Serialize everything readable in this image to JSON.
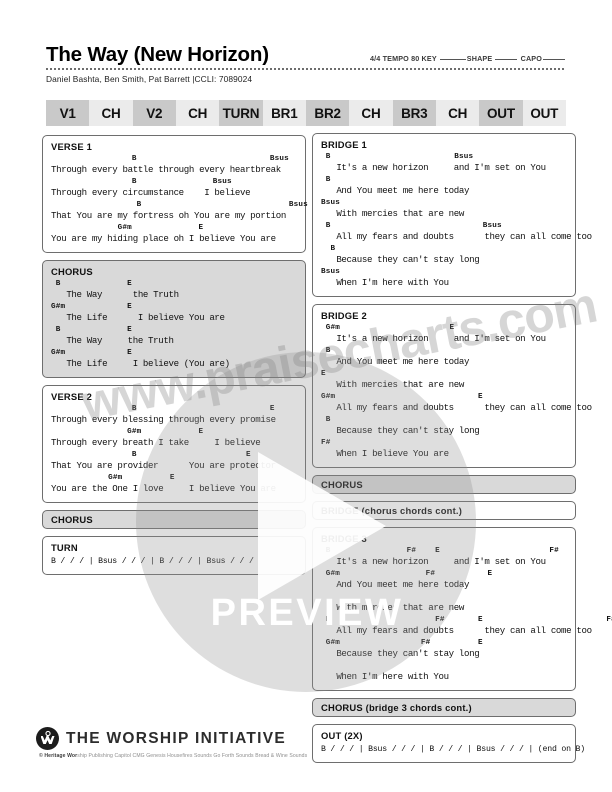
{
  "header": {
    "title": "The Way (New Horizon)",
    "authors": "Daniel Bashta, Ben Smith, Pat Barrett  |CCLI: 7089024",
    "time_signature": "4/4",
    "tempo_label": "TEMPO",
    "tempo_value": "80",
    "key_label": "KEY",
    "shape_label": "SHAPE",
    "capo_label": "CAPO"
  },
  "sequence": [
    {
      "label": "V1",
      "shade": "dark"
    },
    {
      "label": "CH",
      "shade": "light"
    },
    {
      "label": "V2",
      "shade": "dark"
    },
    {
      "label": "CH",
      "shade": "light"
    },
    {
      "label": "TURN",
      "shade": "dark"
    },
    {
      "label": "BR1",
      "shade": "light"
    },
    {
      "label": "BR2",
      "shade": "dark"
    },
    {
      "label": "CH",
      "shade": "light"
    },
    {
      "label": "BR3",
      "shade": "dark"
    },
    {
      "label": "CH",
      "shade": "light"
    },
    {
      "label": "OUT",
      "shade": "dark"
    },
    {
      "label": "OUT",
      "shade": "light"
    }
  ],
  "left_column": {
    "verse1": {
      "label": "VERSE 1",
      "lines": [
        {
          "chords": "                 B                            Bsus",
          "lyrics": "Through every battle through every heartbreak"
        },
        {
          "chords": "                 B                Bsus",
          "lyrics": "Through every circumstance    I believe"
        },
        {
          "chords": "                  B                               Bsus",
          "lyrics": "That You are my fortress oh You are my portion"
        },
        {
          "chords": "              G#m              E",
          "lyrics": "You are my hiding place oh I believe You are"
        }
      ]
    },
    "chorus1": {
      "label": "CHORUS",
      "lines": [
        {
          "chords": " B              E",
          "lyrics": "   The Way      the Truth"
        },
        {
          "chords": "G#m             E",
          "lyrics": "   The Life      I believe You are"
        },
        {
          "chords": " B              E",
          "lyrics": "   The Way     the Truth"
        },
        {
          "chords": "G#m             E",
          "lyrics": "   The Life     I believe (You are)"
        }
      ]
    },
    "verse2": {
      "label": "VERSE 2",
      "lines": [
        {
          "chords": "                 B                            E",
          "lyrics": "Through every blessing through every promise"
        },
        {
          "chords": "                G#m            E",
          "lyrics": "Through every breath I take     I believe"
        },
        {
          "chords": "                 B                       E",
          "lyrics": "That You are provider      You are protector"
        },
        {
          "chords": "            G#m          E",
          "lyrics": "You are the One I love     I believe You are"
        }
      ]
    },
    "chorus2": {
      "label": "CHORUS"
    },
    "turn": {
      "label": "TURN",
      "chords": "B / / / | Bsus / / / | B / / / | Bsus / / /"
    }
  },
  "right_column": {
    "bridge1": {
      "label": "BRIDGE 1",
      "lines": [
        {
          "chords": " B                          Bsus",
          "lyrics": "   It's a new horizon     and I'm set on You"
        },
        {
          "chords": " B",
          "lyrics": "   And You meet me here today"
        },
        {
          "chords": "Bsus",
          "lyrics": "   With mercies that are new"
        },
        {
          "chords": " B                                Bsus",
          "lyrics": "   All my fears and doubts      they can all come too"
        },
        {
          "chords": "  B",
          "lyrics": "   Because they can't stay long"
        },
        {
          "chords": "Bsus",
          "lyrics": "   When I'm here with You"
        }
      ]
    },
    "bridge2": {
      "label": "BRIDGE 2",
      "lines": [
        {
          "chords": " G#m                       E",
          "lyrics": "   It's a new horizon     and I'm set on You"
        },
        {
          "chords": " B",
          "lyrics": "   And You meet me here today"
        },
        {
          "chords": "E",
          "lyrics": "   With mercies that are new"
        },
        {
          "chords": "G#m                              E",
          "lyrics": "   All my fears and doubts      they can all come too"
        },
        {
          "chords": " B",
          "lyrics": "   Because they can't stay long"
        },
        {
          "chords": "F#",
          "lyrics": "   When I believe You are"
        }
      ]
    },
    "chorus3": {
      "label": "CHORUS"
    },
    "bridge_cont": {
      "label": "BRIDGE (chorus chords cont.)"
    },
    "bridge3": {
      "label": "BRIDGE 3",
      "lines": [
        {
          "chords": " B                F#    E                       F#",
          "lyrics": "   It's a new horizon     and I'm set on You"
        },
        {
          "chords": " G#m                  F#           E",
          "lyrics": "   And You meet me here today"
        },
        {
          "chords": "",
          "lyrics": "   With mercies that are new"
        },
        {
          "chords": " B                      F#       E                          F#",
          "lyrics": "   All my fears and doubts      they can all come too"
        },
        {
          "chords": " G#m                 F#          E",
          "lyrics": "   Because they can't stay long"
        },
        {
          "chords": "",
          "lyrics": "   When I'm here with You"
        }
      ]
    },
    "chorus4": {
      "label": "CHORUS (bridge 3 chords cont.)"
    },
    "out": {
      "label": "OUT (2X)",
      "chords": "B / / / | Bsus / / / | B / / / | Bsus / / / | (end on B)"
    }
  },
  "footer": {
    "brand": "THE WORSHIP INITIATIVE",
    "copyright_strong": "© Heritage Wor",
    "copyright_rest": "ship Publishing Capitol CMG Genesis Housefires Sounds Go Forth Sounds Bread & Wine Sounds"
  },
  "watermark": {
    "url_text": "www.praisecharts.com",
    "preview_text": "PREVIEW"
  }
}
